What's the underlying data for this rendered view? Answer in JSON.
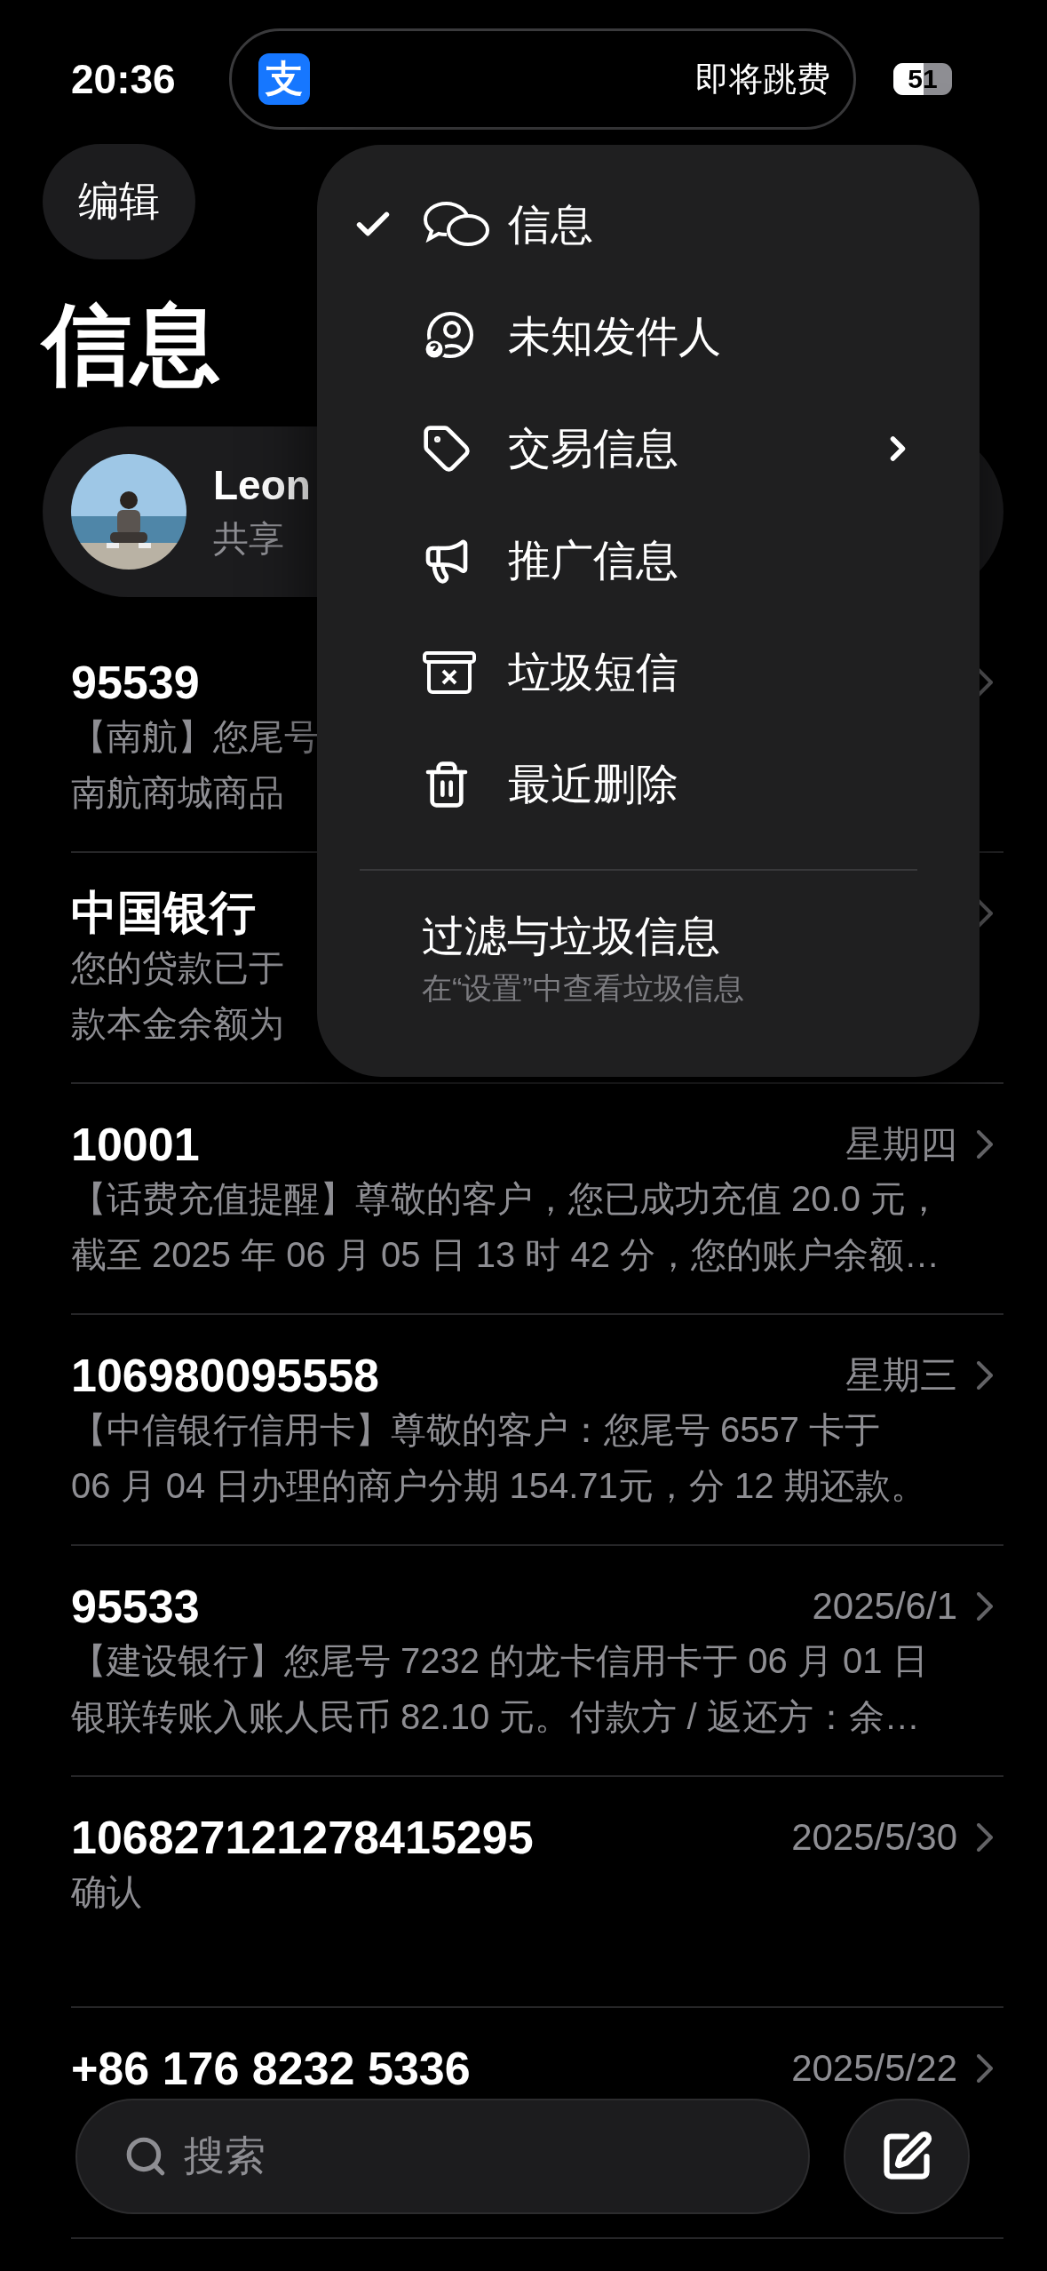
{
  "status_bar": {
    "time": "20:36",
    "island_app_icon": "支",
    "island_text": "即将跳费",
    "battery": "51"
  },
  "nav": {
    "edit_button": "编辑"
  },
  "title": "信息",
  "pinned": {
    "name": "Leon",
    "subtitle": "共享"
  },
  "conversations": [
    {
      "sender": "95539",
      "preview": [
        "【南航】您尾号",
        "南航商城商品"
      ]
    },
    {
      "sender": "中国银行",
      "preview": [
        "您的贷款已于",
        "款本金余额为"
      ]
    },
    {
      "sender": "10001",
      "date": "星期四",
      "preview": [
        "【话费充值提醒】尊敬的客户，您已成功充值 20.0 元，",
        "截至 2025 年 06 月 05 日 13 时 42 分，您的账户余额…"
      ]
    },
    {
      "sender": "106980095558",
      "date": "星期三",
      "preview": [
        "【中信银行信用卡】尊敬的客户：您尾号 6557 卡于",
        "06 月 04 日办理的商户分期 154.71元，分 12 期还款。"
      ]
    },
    {
      "sender": "95533",
      "date": "2025/6/1",
      "preview": [
        "【建设银行】您尾号 7232 的龙卡信用卡于 06 月 01 日",
        "银联转账入账人民币 82.10 元。付款方 / 返还方：余…"
      ]
    },
    {
      "sender": "106827121278415295",
      "date": "2025/5/30",
      "preview": [
        "确认"
      ]
    },
    {
      "sender": "+86 176 8232 5336",
      "date": "2025/5/22"
    }
  ],
  "menu": {
    "items": [
      {
        "label": "信息",
        "selected": true,
        "submenu": false
      },
      {
        "label": "未知发件人",
        "selected": false,
        "submenu": false
      },
      {
        "label": "交易信息",
        "selected": false,
        "submenu": true
      },
      {
        "label": "推广信息",
        "selected": false,
        "submenu": false
      },
      {
        "label": "垃圾短信",
        "selected": false,
        "submenu": false
      },
      {
        "label": "最近删除",
        "selected": false,
        "submenu": false
      }
    ],
    "footer": {
      "title": "过滤与垃圾信息",
      "subtitle": "在“设置”中查看垃圾信息"
    }
  },
  "search": {
    "placeholder": "搜索"
  }
}
